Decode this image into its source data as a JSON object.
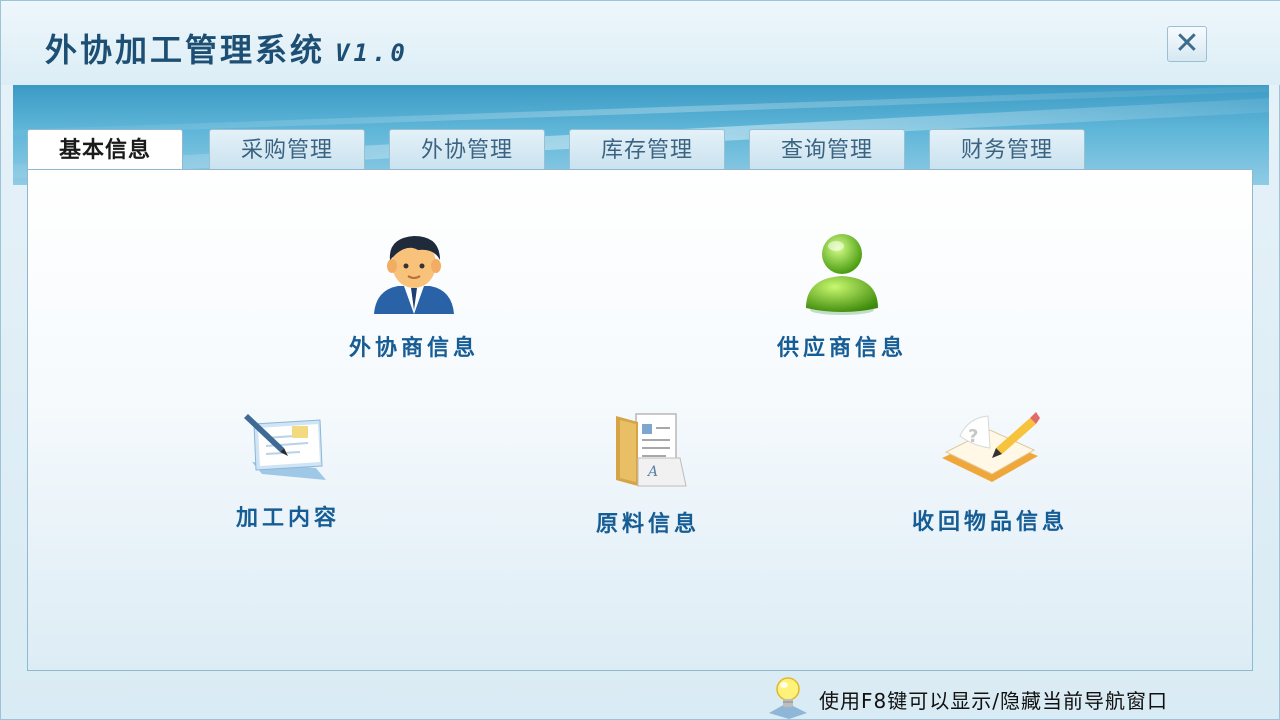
{
  "window": {
    "title": "外协加工管理系统",
    "version": "V1.0",
    "close_label": "✕"
  },
  "tabs": [
    {
      "label": "基本信息",
      "active": true
    },
    {
      "label": "采购管理",
      "active": false
    },
    {
      "label": "外协管理",
      "active": false
    },
    {
      "label": "库存管理",
      "active": false
    },
    {
      "label": "查询管理",
      "active": false
    },
    {
      "label": "财务管理",
      "active": false
    }
  ],
  "tiles": [
    {
      "label": "外协商信息",
      "icon": "business-person-icon"
    },
    {
      "label": "供应商信息",
      "icon": "green-user-icon"
    },
    {
      "label": "加工内容",
      "icon": "document-pen-icon"
    },
    {
      "label": "原料信息",
      "icon": "folder-documents-icon"
    },
    {
      "label": "收回物品信息",
      "icon": "notebook-pencil-icon"
    }
  ],
  "status": {
    "hint": "使用F8键可以显示/隐藏当前导航窗口",
    "icon": "lightbulb-icon"
  },
  "colors": {
    "title": "#1c4f73",
    "tile_label": "#175d95",
    "banner": "#3b9ac4"
  }
}
